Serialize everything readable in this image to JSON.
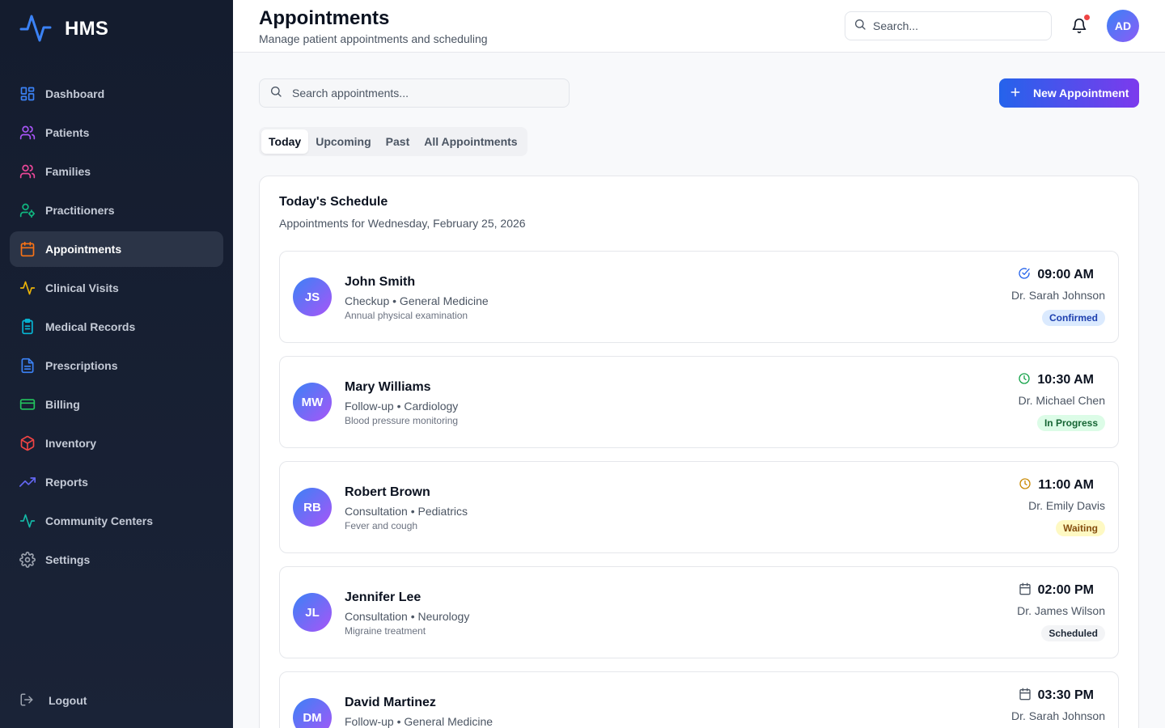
{
  "brand": {
    "name": "HMS",
    "accent": "#3b82f6"
  },
  "sidebar": {
    "items": [
      {
        "label": "Dashboard",
        "icon": "dashboard-icon",
        "color": "#3b82f6",
        "active": false
      },
      {
        "label": "Patients",
        "icon": "users-icon",
        "color": "#a855f7",
        "active": false
      },
      {
        "label": "Families",
        "icon": "users-icon",
        "color": "#ec4899",
        "active": false
      },
      {
        "label": "Practitioners",
        "icon": "user-cog-icon",
        "color": "#10b981",
        "active": false
      },
      {
        "label": "Appointments",
        "icon": "calendar-icon",
        "color": "#f97316",
        "active": true
      },
      {
        "label": "Clinical Visits",
        "icon": "activity-icon",
        "color": "#eab308",
        "active": false
      },
      {
        "label": "Medical Records",
        "icon": "clipboard-icon",
        "color": "#06b6d4",
        "active": false
      },
      {
        "label": "Prescriptions",
        "icon": "file-text-icon",
        "color": "#3b82f6",
        "active": false
      },
      {
        "label": "Billing",
        "icon": "credit-card-icon",
        "color": "#22c55e",
        "active": false
      },
      {
        "label": "Inventory",
        "icon": "package-icon",
        "color": "#ef4444",
        "active": false
      },
      {
        "label": "Reports",
        "icon": "trending-up-icon",
        "color": "#6366f1",
        "active": false
      },
      {
        "label": "Community Centers",
        "icon": "activity-icon",
        "color": "#14b8a6",
        "active": false
      },
      {
        "label": "Settings",
        "icon": "gear-icon",
        "color": "#9ca3af",
        "active": false
      }
    ],
    "logout_label": "Logout"
  },
  "header": {
    "title": "Appointments",
    "subtitle": "Manage patient appointments and scheduling",
    "search_placeholder": "Search...",
    "notification_dot_color": "#ef4444",
    "user_initials": "AD"
  },
  "toolbar": {
    "search_placeholder": "Search appointments...",
    "new_button_label": "New Appointment"
  },
  "tabs": [
    {
      "label": "Today",
      "active": true
    },
    {
      "label": "Upcoming",
      "active": false
    },
    {
      "label": "Past",
      "active": false
    },
    {
      "label": "All Appointments",
      "active": false
    }
  ],
  "schedule": {
    "title": "Today's Schedule",
    "subtitle": "Appointments for Wednesday, February 25, 2026",
    "appointments": [
      {
        "initials": "JS",
        "name": "John Smith",
        "type": "Checkup • General Medicine",
        "note": "Annual physical examination",
        "time": "09:00 AM",
        "time_icon": "check-circle-icon",
        "icon_color": "#2563eb",
        "doctor": "Dr. Sarah Johnson",
        "status": "Confirmed",
        "status_bg": "#dbeafe",
        "status_fg": "#1e40af"
      },
      {
        "initials": "MW",
        "name": "Mary Williams",
        "type": "Follow-up • Cardiology",
        "note": "Blood pressure monitoring",
        "time": "10:30 AM",
        "time_icon": "clock-icon",
        "icon_color": "#16a34a",
        "doctor": "Dr. Michael Chen",
        "status": "In Progress",
        "status_bg": "#dcfce7",
        "status_fg": "#166534"
      },
      {
        "initials": "RB",
        "name": "Robert Brown",
        "type": "Consultation • Pediatrics",
        "note": "Fever and cough",
        "time": "11:00 AM",
        "time_icon": "clock-icon",
        "icon_color": "#ca8a04",
        "doctor": "Dr. Emily Davis",
        "status": "Waiting",
        "status_bg": "#fef9c3",
        "status_fg": "#854d0e"
      },
      {
        "initials": "JL",
        "name": "Jennifer Lee",
        "type": "Consultation • Neurology",
        "note": "Migraine treatment",
        "time": "02:00 PM",
        "time_icon": "calendar-icon",
        "icon_color": "#4b5563",
        "doctor": "Dr. James Wilson",
        "status": "Scheduled",
        "status_bg": "#f3f4f6",
        "status_fg": "#1f2937"
      },
      {
        "initials": "DM",
        "name": "David Martinez",
        "type": "Follow-up • General Medicine",
        "note": "",
        "time": "03:30 PM",
        "time_icon": "calendar-icon",
        "icon_color": "#4b5563",
        "doctor": "Dr. Sarah Johnson",
        "status": "",
        "status_bg": "#f3f4f6",
        "status_fg": "#1f2937"
      }
    ]
  }
}
